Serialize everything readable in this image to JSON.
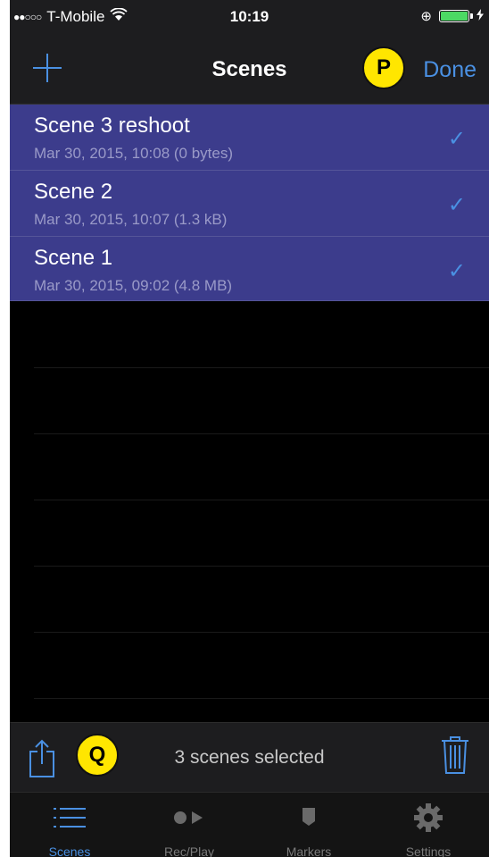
{
  "status_bar": {
    "signal": "●●○○○",
    "carrier": "T-Mobile",
    "time": "10:19",
    "lock_glyph": "⊕"
  },
  "nav": {
    "title": "Scenes",
    "done_label": "Done",
    "badge_label": "P"
  },
  "scenes": [
    {
      "name": "Scene 3 reshoot",
      "meta": "Mar 30, 2015, 10:08  (0 bytes)",
      "selected": true
    },
    {
      "name": "Scene 2",
      "meta": "Mar 30, 2015, 10:07  (1.3 kB)",
      "selected": true
    },
    {
      "name": "Scene 1",
      "meta": "Mar 30, 2015, 09:02  (4.8 MB)",
      "selected": true
    }
  ],
  "check_glyph": "✓",
  "action_bar": {
    "selected_text": "3 scenes selected",
    "badge_label": "Q"
  },
  "tabs": [
    {
      "label": "Scenes",
      "icon": "list-icon",
      "active": true
    },
    {
      "label": "Rec/Play",
      "icon": "record-play-icon",
      "active": false
    },
    {
      "label": "Markers",
      "icon": "marker-icon",
      "active": false
    },
    {
      "label": "Settings",
      "icon": "gear-icon",
      "active": false
    }
  ],
  "colors": {
    "accent": "#4a90e2",
    "selection": "#3c3c8c",
    "badge": "#ffe600"
  }
}
